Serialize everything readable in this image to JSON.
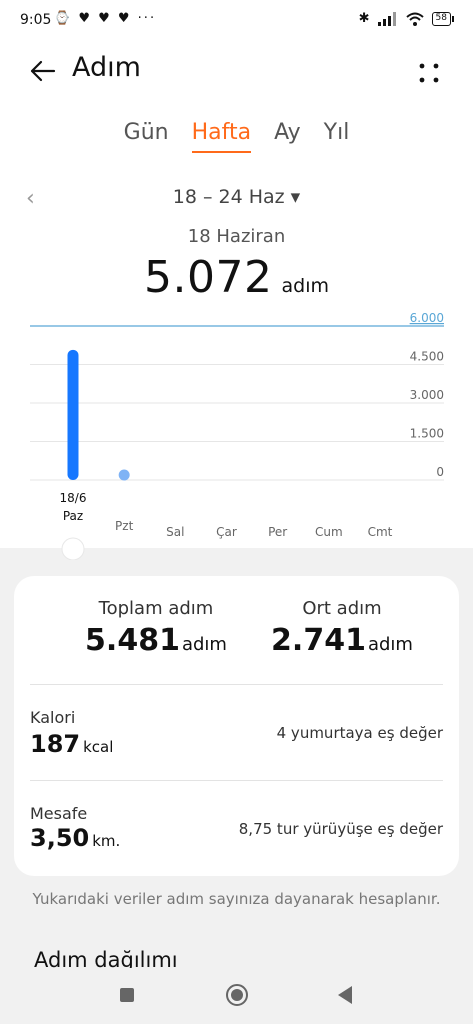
{
  "status": {
    "time": "9:05",
    "notifications": "⌚ ♥ ♥ ♥ ···",
    "battery": "58"
  },
  "header": {
    "title": "Adım"
  },
  "tabs": [
    {
      "label": "Gün",
      "active": false
    },
    {
      "label": "Hafta",
      "active": true
    },
    {
      "label": "Ay",
      "active": false
    },
    {
      "label": "Yıl",
      "active": false
    }
  ],
  "range": {
    "label": "18 – 24 Haz ▾"
  },
  "selected": {
    "date": "18 Haziran",
    "steps": "5.072",
    "unit": "adım"
  },
  "chart_data": {
    "type": "bar",
    "categories": [
      "Paz",
      "Pzt",
      "Sal",
      "Çar",
      "Per",
      "Cum",
      "Cmt"
    ],
    "selected_category_top": "18/6",
    "values": [
      5072,
      409,
      0,
      0,
      0,
      0,
      0
    ],
    "y_ticks": [
      "6.000",
      "4.500",
      "3.000",
      "1.500",
      "0"
    ],
    "y_tick_values": [
      6000,
      4500,
      3000,
      1500,
      0
    ],
    "ylim": [
      0,
      6000
    ],
    "selected_index": 0,
    "colors": {
      "bar": "#1677ff",
      "bar_light": "#7fb3f5",
      "goal_line": "#5aa7d6"
    }
  },
  "summary": {
    "total_label": "Toplam adım",
    "total_value": "5.481",
    "total_unit": "adım",
    "avg_label": "Ort adım",
    "avg_value": "2.741",
    "avg_unit": "adım",
    "calorie_label": "Kalori",
    "calorie_value": "187",
    "calorie_unit": "kcal",
    "calorie_equiv": "4 yumurtaya eş değer",
    "distance_label": "Mesafe",
    "distance_value": "3,50",
    "distance_unit": "km.",
    "distance_equiv": "8,75 tur yürüyüşe eş değer"
  },
  "note": "Yukarıdaki veriler adım sayınıza dayanarak hesaplanır.",
  "distribution_title": "Adım dağılımı"
}
